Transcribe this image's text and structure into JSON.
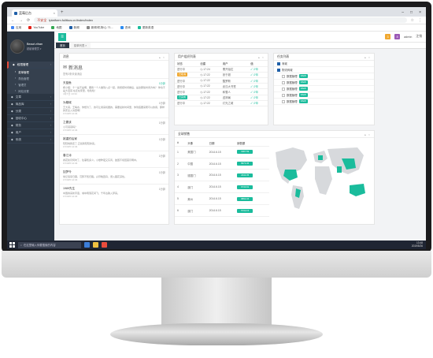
{
  "browser": {
    "tab_title": "蓝莓后台",
    "url_warning": "不安全",
    "url": "tplatform.fulitkus.cn/index/index",
    "bookmarks": [
      "应用",
      "YouTube",
      "地图",
      "新闻",
      "新闻/机场/心 71...",
      "咨询",
      "更新英语"
    ]
  },
  "sidebar": {
    "user_name": "Beaut zihan",
    "user_role": "超级管理员 ▾",
    "menu": [
      {
        "label": "权限管理",
        "active": true
      },
      {
        "label": "菜单管理",
        "sub": true,
        "on": true
      },
      {
        "label": "角色管理",
        "sub": true
      },
      {
        "label": "管理员",
        "sub": true
      },
      {
        "label": "网站设置",
        "sub": true
      },
      {
        "label": "文章"
      },
      {
        "label": "商品库"
      },
      {
        "label": "分类"
      },
      {
        "label": "回收中心"
      },
      {
        "label": "财务"
      },
      {
        "label": "用户"
      },
      {
        "label": "系统"
      }
    ]
  },
  "topbar": {
    "badge1": "3",
    "badge2": "8",
    "admin_label": "admin",
    "logout": "注销"
  },
  "tabs": [
    {
      "label": "首页",
      "on": true
    },
    {
      "label": "菜单列表 ×",
      "on": false
    }
  ],
  "messages": {
    "panel_title": "消息",
    "title": "新消息",
    "subtitle": "您有3条未读消息",
    "items": [
      {
        "title": "天蓝鱼",
        "time": "1分钟",
        "hot": true,
        "body": "希小姐：十一是不是啊，要我一个人做到八点一起，我想把时间推后，是这那些时间方向？ 你也不是大哥哥 在还在家里，哈哈哈！",
        "meta": "4月7日 10:34"
      },
      {
        "title": "为箱城",
        "time": "1分钟",
        "hot": false,
        "body": "王大哥，王喝水，你想为了，的可让用来机器的，需要最新时间里，你到底要来帮可以的用，那样的安全入请里啊！",
        "meta": "17/4/25 14:34"
      },
      {
        "title": "之要该",
        "time": "1分钟",
        "hot": false,
        "body": "小可哥哥吗？",
        "meta": "17/4/25 14:34"
      },
      {
        "title": "姚重的后家",
        "time": "1分钟",
        "hot": false,
        "body": "轻轻地我走了,正如我轻轻的来。",
        "meta": "17/4/25 14:34"
      },
      {
        "title": "春江诗",
        "time": "1分钟",
        "hot": false,
        "body": "春花秋月何时了，往事知多少。小楼昨夜又东风，故国不堪回首月明中。",
        "meta": "17/4/25 14:34"
      },
      {
        "title": "如梦令",
        "time": "1分钟",
        "hot": false,
        "body": "常记溪亭日暮，沉醉不知归路。兴尽晚回舟，误入藕花深处。",
        "meta": "17/4/25 14:34"
      },
      {
        "title": "1989先生",
        "time": "1分钟",
        "hot": false,
        "body": "中国春来新宇宙，城中雨落花间飞，千年古韵入梦来。",
        "meta": "17/4/25 14:34"
      }
    ]
  },
  "users": {
    "panel_title": "用户组织列表",
    "headers": [
      "状态",
      "创建",
      "用户",
      "值"
    ],
    "rows": [
      {
        "status": "进行中",
        "badge": "",
        "time": "17:24",
        "user": "需开始拉",
        "val": "少年"
      },
      {
        "status": "已取消",
        "badge": "#f0a830",
        "time": "17:22",
        "user": "张于超",
        "val": "少年"
      },
      {
        "status": "进行中",
        "badge": "",
        "time": "17:22",
        "user": "酷罗斯",
        "val": "少年"
      },
      {
        "status": "进行中",
        "badge": "",
        "time": "17:22",
        "user": "武汉大书签",
        "val": "少年"
      },
      {
        "status": "进行中",
        "badge": "",
        "time": "17:22",
        "user": "和雪人",
        "val": "少年"
      },
      {
        "status": "已完成",
        "badge": "#1abc9c",
        "time": "17:22",
        "user": "送清暑",
        "val": "少年"
      },
      {
        "status": "进行中",
        "badge": "",
        "time": "17:22",
        "user": "灯光之城",
        "val": "少年"
      }
    ]
  },
  "tasks": {
    "panel_title": "任务列表",
    "items": [
      {
        "label": "商城",
        "checked": true,
        "indent": false,
        "btn": ""
      },
      {
        "label": "物流商城",
        "checked": true,
        "indent": false,
        "btn": ""
      },
      {
        "label": "数据管理",
        "checked": false,
        "indent": true,
        "btn": "VIEW"
      },
      {
        "label": "数据管理",
        "checked": false,
        "indent": true,
        "btn": "VIEW"
      },
      {
        "label": "数据管理",
        "checked": false,
        "indent": true,
        "btn": "VIEW"
      },
      {
        "label": "数据管理",
        "checked": false,
        "indent": true,
        "btn": "VIEW"
      },
      {
        "label": "数据管理",
        "checked": false,
        "indent": true,
        "btn": "VIEW"
      }
    ]
  },
  "sales": {
    "panel_title": "全球销售",
    "headers": [
      "#",
      "头像",
      "日期",
      "销售额"
    ],
    "rows": [
      {
        "n": "1",
        "name": "美国门",
        "date": "2014.6.15",
        "amount": "1987.59"
      },
      {
        "n": "2",
        "name": "中国",
        "date": "2014.6.15",
        "amount": "8973.45"
      },
      {
        "n": "3",
        "name": "德国门",
        "date": "2014.6.15",
        "amount": "2342.35"
      },
      {
        "n": "4",
        "name": "澳门",
        "date": "2014.6.15",
        "amount": "6743.91"
      },
      {
        "n": "5",
        "name": "美州",
        "date": "2014.6.15",
        "amount": "9892.34"
      },
      {
        "n": "6",
        "name": "澳门",
        "date": "2014.6.15",
        "amount": "5732.15"
      }
    ]
  },
  "taskbar": {
    "search": "在这里输入你要搜索的内容",
    "time": "13:48",
    "date": "2019/5/26"
  },
  "colors": {
    "accent": "#1abc9c",
    "sidebar": "#2b3643",
    "warn": "#f0a830"
  }
}
